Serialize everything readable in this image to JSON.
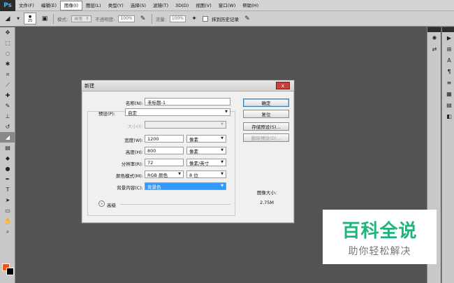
{
  "app": {
    "logo": "Ps"
  },
  "menu": [
    {
      "label": "文件(F)"
    },
    {
      "label": "编辑(E)"
    },
    {
      "label": "图像(I)",
      "active": true
    },
    {
      "label": "图层(L)"
    },
    {
      "label": "类型(Y)"
    },
    {
      "label": "选择(S)"
    },
    {
      "label": "滤镜(T)"
    },
    {
      "label": "3D(D)"
    },
    {
      "label": "视图(V)"
    },
    {
      "label": "窗口(W)"
    },
    {
      "label": "帮助(H)"
    }
  ],
  "options": {
    "brush_size": "25",
    "mode_label": "模式:",
    "mode_value": "画笔",
    "opacity_label": "不透明度:",
    "opacity_value": "100%",
    "flow_label": "流量:",
    "flow_value": "100%",
    "history_label": "抹到历史记录"
  },
  "dialog": {
    "title": "新建",
    "close": "x",
    "name_label": "名称(N):",
    "name_value": "未标题-1",
    "preset_label": "预设(P):",
    "preset_value": "自定",
    "size_label": "大小(I):",
    "width_label": "宽度(W):",
    "width_value": "1200",
    "width_unit": "像素",
    "height_label": "高度(H):",
    "height_value": "800",
    "height_unit": "像素",
    "resolution_label": "分辨率(R):",
    "resolution_value": "72",
    "resolution_unit": "像素/英寸",
    "colormode_label": "颜色模式(M):",
    "colormode_value": "RGB 颜色",
    "bitdepth_value": "8 位",
    "background_label": "背景内容(C):",
    "background_value": "背景色",
    "advanced_label": "高级",
    "buttons": {
      "ok": "确定",
      "reset": "复位",
      "save_preset": "存储预设(S)...",
      "delete_preset": "删除预设(D)..."
    },
    "image_size_label": "图像大小:",
    "image_size_value": "2.75M"
  },
  "colors": {
    "foreground": "#e8571d",
    "background": "#000000"
  },
  "watermark": {
    "title": "百科全说",
    "subtitle": "助你轻松解决"
  }
}
